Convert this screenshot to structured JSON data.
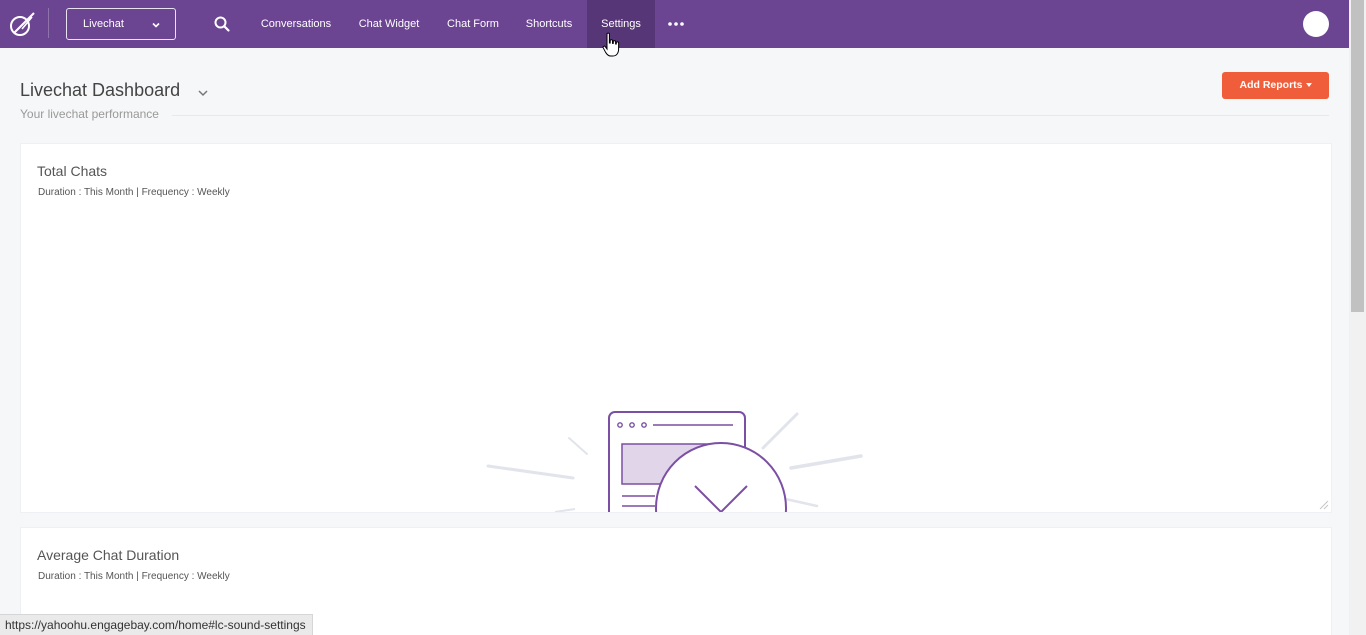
{
  "topnav": {
    "app_selector": "Livechat",
    "items": [
      {
        "label": "Conversations",
        "active": false
      },
      {
        "label": "Chat Widget",
        "active": false
      },
      {
        "label": "Chat Form",
        "active": false
      },
      {
        "label": "Shortcuts",
        "active": false
      },
      {
        "label": "Settings",
        "active": true
      }
    ],
    "icons": [
      "logo-icon",
      "search-icon",
      "more-icon",
      "avatar"
    ]
  },
  "header": {
    "title": "Livechat Dashboard",
    "subtitle": "Your livechat performance",
    "add_reports_label": "Add Reports"
  },
  "cards": [
    {
      "title": "Total Chats",
      "meta": "Duration : This Month | Frequency : Weekly"
    },
    {
      "title": "Average Chat Duration",
      "meta": "Duration : This Month | Frequency : Weekly"
    }
  ],
  "status_bar": {
    "url": "https://yahoohu.engagebay.com/home#lc-sound-settings"
  },
  "colors": {
    "nav_bg": "#6b4591",
    "nav_active_bg": "#573677",
    "accent_button": "#f05d3b",
    "page_bg": "#f6f7f9",
    "illustration_purple": "#7b4fa3"
  }
}
